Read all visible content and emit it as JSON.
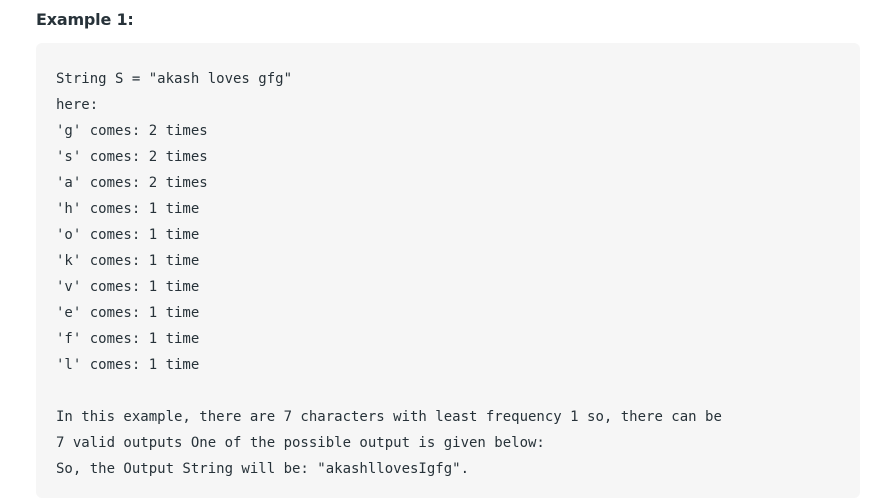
{
  "heading": "Example 1:",
  "code_lines": [
    "String S = \"akash loves gfg\"",
    "here:",
    "'g' comes: 2 times",
    "'s' comes: 2 times",
    "'a' comes: 2 times",
    "'h' comes: 1 time",
    "'o' comes: 1 time",
    "'k' comes: 1 time",
    "'v' comes: 1 time",
    "'e' comes: 1 time",
    "'f' comes: 1 time",
    "'l' comes: 1 time",
    "",
    "In this example, there are 7 characters with least frequency 1 so, there can be",
    "7 valid outputs One of the possible output is given below:",
    "So, the Output String will be: \"akashllovesIgfg\"."
  ]
}
